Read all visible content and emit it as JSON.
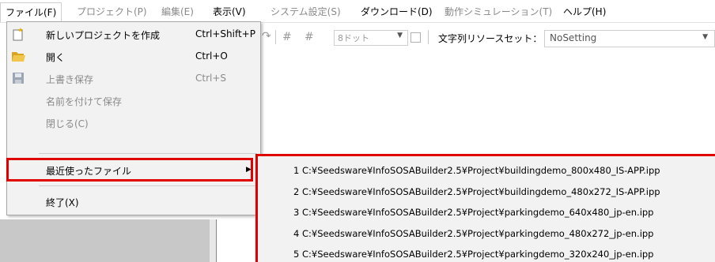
{
  "menubar": {
    "items": [
      {
        "label": "ファイル(F)",
        "state": "active"
      },
      {
        "label": "プロジェクト(P)",
        "state": "disabled"
      },
      {
        "label": "編集(E)",
        "state": "disabled"
      },
      {
        "label": "表示(V)",
        "state": "normal"
      },
      {
        "label": "システム設定(S)",
        "state": "disabled"
      },
      {
        "label": "ダウンロード(D)",
        "state": "normal"
      },
      {
        "label": "動作シミュレーション(T)",
        "state": "disabled"
      },
      {
        "label": "ヘルプ(H)",
        "state": "normal"
      }
    ]
  },
  "toolbar": {
    "dot_combo_value": "8ドット",
    "resource_label": "文字列リソースセット：",
    "resource_value": "NoSetting"
  },
  "file_menu": {
    "items": [
      {
        "label": "新しいプロジェクトを作成",
        "shortcut": "Ctrl+Shift+P",
        "icon": "new-project-icon"
      },
      {
        "label": "開く",
        "shortcut": "Ctrl+O",
        "icon": "open-folder-icon"
      },
      {
        "label": "上書き保存",
        "shortcut": "Ctrl+S",
        "icon": "save-icon"
      },
      {
        "label": "名前を付けて保存",
        "shortcut": ""
      },
      {
        "label": "閉じる(C)",
        "shortcut": ""
      },
      {
        "label": "最近使ったファイル",
        "shortcut": ""
      },
      {
        "label": "終了(X)",
        "shortcut": ""
      }
    ]
  },
  "recent_files": [
    "1 C:¥Seedsware¥InfoSOSABuilder2.5¥Project¥buildingdemo_800x480_IS-APP.ipp",
    "2 C:¥Seedsware¥InfoSOSABuilder2.5¥Project¥buildingdemo_480x272_IS-APP.ipp",
    "3 C:¥Seedsware¥InfoSOSABuilder2.5¥Project¥parkingdemo_640x480_jp-en.ipp",
    "4 C:¥Seedsware¥InfoSOSABuilder2.5¥Project¥parkingdemo_480x272_jp-en.ipp",
    "5 C:¥Seedsware¥InfoSOSABuilder2.5¥Project¥parkingdemo_320x240_jp-en.ipp"
  ]
}
